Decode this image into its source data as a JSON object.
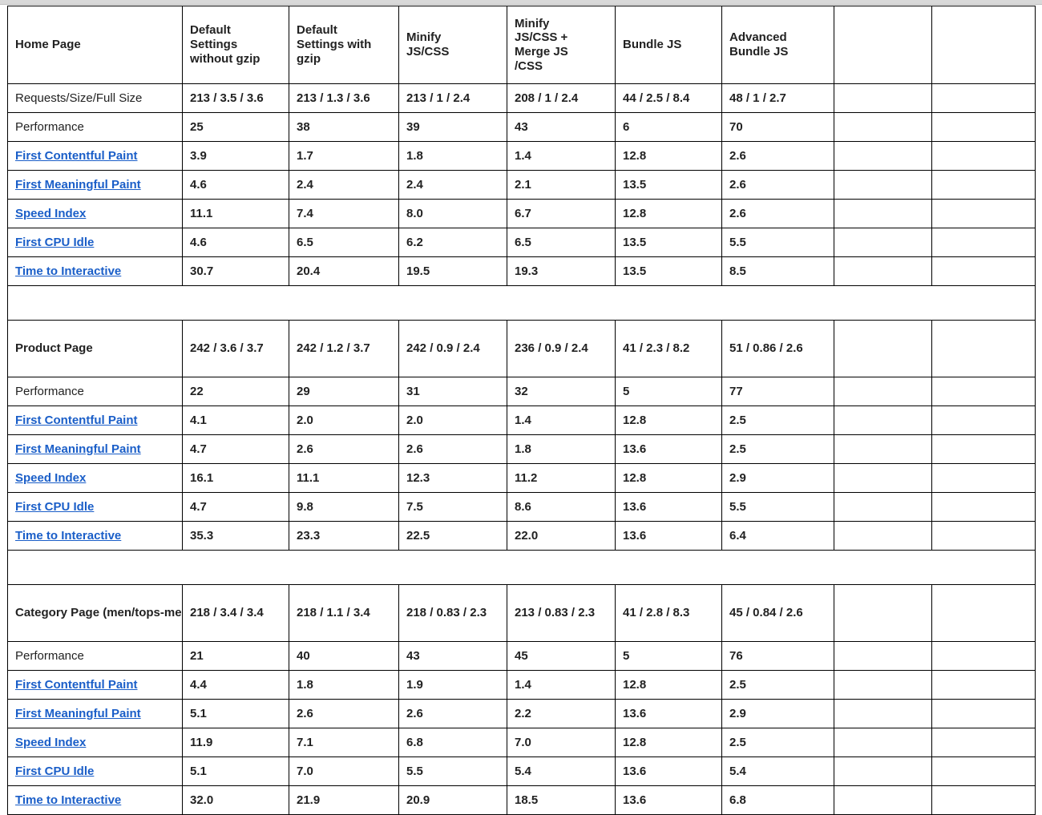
{
  "table": {
    "columns": [
      "",
      "Default Settings without  gzip",
      "Default Settings with gzip",
      "Minify JS/CSS",
      "Minify JS/CSS + Merge JS /CSS",
      "Bundle JS",
      "Advanced Bundle JS",
      "",
      ""
    ],
    "header": {
      "title": "Home Page",
      "scenarios": [
        "Default\nSettings\nwithout  gzip",
        "Default\nSettings with\ngzip",
        "Minify\nJS/CSS",
        "Minify\nJS/CSS +\nMerge JS\n/CSS",
        "Bundle JS",
        "Advanced\nBundle JS",
        "",
        ""
      ]
    },
    "sections": [
      {
        "id": "home-page",
        "title": "Home Page",
        "is_header_section": true,
        "rows": [
          {
            "label": "Requests/Size/Full Size",
            "label_style": "plain",
            "cells": [
              {
                "text": "213 / 3.5 / 3.6",
                "color": "black"
              },
              {
                "text": "213 / 1.3 / 3.6",
                "color": "black"
              },
              {
                "text": "213 / 1 / 2.4",
                "color": "black"
              },
              {
                "text": "208 / 1 / 2.4",
                "color": "black"
              },
              {
                "text": "44 / 2.5 / 8.4",
                "color": "black"
              },
              {
                "text": "48 / 1 / 2.7",
                "color": "black"
              },
              {
                "text": "",
                "color": "black"
              },
              {
                "text": "",
                "color": "black"
              }
            ]
          },
          {
            "label": "Performance",
            "label_style": "plain",
            "cells": [
              {
                "text": "25",
                "color": "black"
              },
              {
                "text": "38",
                "color": "black"
              },
              {
                "text": "39",
                "color": "black"
              },
              {
                "text": "43",
                "color": "black"
              },
              {
                "text": "6",
                "color": "black"
              },
              {
                "text": "70",
                "color": "black"
              },
              {
                "text": "",
                "color": "black"
              },
              {
                "text": "",
                "color": "black"
              }
            ]
          },
          {
            "label": "First Contentful Paint",
            "label_style": "link",
            "cells": [
              {
                "text": "3.9",
                "color": "orange"
              },
              {
                "text": "1.7",
                "color": "green"
              },
              {
                "text": "1.8",
                "color": "green"
              },
              {
                "text": "1.4",
                "color": "green"
              },
              {
                "text": "12.8",
                "color": "red"
              },
              {
                "text": "2.6",
                "color": "orange"
              },
              {
                "text": "",
                "color": "black"
              },
              {
                "text": "",
                "color": "black"
              }
            ]
          },
          {
            "label": "First Meaningful Paint",
            "label_style": "link",
            "cells": [
              {
                "text": "4.6",
                "color": "red"
              },
              {
                "text": "2.4",
                "color": "orange"
              },
              {
                "text": "2.4",
                "color": "orange"
              },
              {
                "text": "2.1",
                "color": "green"
              },
              {
                "text": "13.5",
                "color": "red"
              },
              {
                "text": "2.6",
                "color": "orange"
              },
              {
                "text": "",
                "color": "black"
              },
              {
                "text": "",
                "color": "black"
              }
            ]
          },
          {
            "label": "Speed Index",
            "label_style": "link",
            "cells": [
              {
                "text": "11.1",
                "color": "red"
              },
              {
                "text": "7.4",
                "color": "red"
              },
              {
                "text": "8.0",
                "color": "red"
              },
              {
                "text": "6.7",
                "color": "red"
              },
              {
                "text": "12.8",
                "color": "red"
              },
              {
                "text": "2.6",
                "color": "green"
              },
              {
                "text": "",
                "color": "black"
              },
              {
                "text": "",
                "color": "black"
              }
            ]
          },
          {
            "label": "First CPU Idle",
            "label_style": "link",
            "cells": [
              {
                "text": "4.6",
                "color": "orange"
              },
              {
                "text": "6.5",
                "color": "orange"
              },
              {
                "text": "6.2",
                "color": "orange"
              },
              {
                "text": "6.5",
                "color": "red"
              },
              {
                "text": "13.5",
                "color": "red"
              },
              {
                "text": "5.5",
                "color": "orange"
              },
              {
                "text": "",
                "color": "black"
              },
              {
                "text": "",
                "color": "black"
              }
            ]
          },
          {
            "label": "Time to Interactive",
            "label_style": "link",
            "cells": [
              {
                "text": "30.7",
                "color": "red"
              },
              {
                "text": "20.4",
                "color": "red"
              },
              {
                "text": "19.5",
                "color": "red"
              },
              {
                "text": "19.3",
                "color": "red"
              },
              {
                "text": "13.5",
                "color": "red"
              },
              {
                "text": "8.5",
                "color": "red"
              },
              {
                "text": "",
                "color": "black"
              },
              {
                "text": "",
                "color": "black"
              }
            ]
          }
        ]
      },
      {
        "id": "product-page",
        "title": "Product Page",
        "is_header_section": false,
        "header_cells": [
          {
            "text": "242 / 3.6 / 3.7",
            "color": "black"
          },
          {
            "text": "242 / 1.2 / 3.7",
            "color": "black"
          },
          {
            "text": "242 / 0.9 / 2.4",
            "color": "black"
          },
          {
            "text": "236 / 0.9 / 2.4",
            "color": "black"
          },
          {
            "text": "41 / 2.3 / 8.2",
            "color": "black"
          },
          {
            "text": "51 / 0.86 / 2.6",
            "color": "black"
          },
          {
            "text": "",
            "color": "black"
          },
          {
            "text": "",
            "color": "black"
          }
        ],
        "rows": [
          {
            "label": "Performance",
            "label_style": "plain",
            "cells": [
              {
                "text": "22",
                "color": "black"
              },
              {
                "text": "29",
                "color": "black"
              },
              {
                "text": "31",
                "color": "black"
              },
              {
                "text": "32",
                "color": "black"
              },
              {
                "text": "5",
                "color": "black"
              },
              {
                "text": "77",
                "color": "black"
              },
              {
                "text": "",
                "color": "black"
              },
              {
                "text": "",
                "color": "black"
              }
            ]
          },
          {
            "label": "First Contentful Paint",
            "label_style": "link",
            "cells": [
              {
                "text": "4.1",
                "color": "red"
              },
              {
                "text": "2.0",
                "color": "green"
              },
              {
                "text": "2.0",
                "color": "green"
              },
              {
                "text": "1.4",
                "color": "green"
              },
              {
                "text": "12.8",
                "color": "red"
              },
              {
                "text": "2.5",
                "color": "orange"
              },
              {
                "text": "",
                "color": "black"
              },
              {
                "text": "",
                "color": "black"
              }
            ]
          },
          {
            "label": "First Meaningful Paint",
            "label_style": "link",
            "cells": [
              {
                "text": "4.7",
                "color": "red"
              },
              {
                "text": "2.6",
                "color": "orange"
              },
              {
                "text": "2.6",
                "color": "orange"
              },
              {
                "text": "1.8",
                "color": "green"
              },
              {
                "text": "13.6",
                "color": "red"
              },
              {
                "text": "2.5",
                "color": "orange"
              },
              {
                "text": "",
                "color": "black"
              },
              {
                "text": "",
                "color": "black"
              }
            ]
          },
          {
            "label": "Speed Index",
            "label_style": "link",
            "cells": [
              {
                "text": "16.1",
                "color": "red"
              },
              {
                "text": "11.1",
                "color": "red"
              },
              {
                "text": "12.3",
                "color": "red"
              },
              {
                "text": "11.2",
                "color": "red"
              },
              {
                "text": "12.8",
                "color": "red"
              },
              {
                "text": "2.9",
                "color": "green"
              },
              {
                "text": "",
                "color": "black"
              },
              {
                "text": "",
                "color": "black"
              }
            ]
          },
          {
            "label": "First CPU Idle",
            "label_style": "link",
            "cells": [
              {
                "text": "4.7",
                "color": "orange"
              },
              {
                "text": "9.8",
                "color": "red"
              },
              {
                "text": "7.5",
                "color": "red"
              },
              {
                "text": "8.6",
                "color": "red"
              },
              {
                "text": "13.6",
                "color": "red"
              },
              {
                "text": "5.5",
                "color": "orange"
              },
              {
                "text": "",
                "color": "black"
              },
              {
                "text": "",
                "color": "black"
              }
            ]
          },
          {
            "label": "Time to Interactive",
            "label_style": "link",
            "cells": [
              {
                "text": "35.3",
                "color": "red"
              },
              {
                "text": "23.3",
                "color": "red"
              },
              {
                "text": "22.5",
                "color": "red"
              },
              {
                "text": "22.0",
                "color": "red"
              },
              {
                "text": "13.6",
                "color": "red"
              },
              {
                "text": "6.4",
                "color": "orange"
              },
              {
                "text": "",
                "color": "black"
              },
              {
                "text": "",
                "color": "black"
              }
            ]
          }
        ]
      },
      {
        "id": "category-page",
        "title": "Category Page (men/tops-men.html)",
        "is_header_section": false,
        "header_cells": [
          {
            "text": "218 / 3.4 / 3.4",
            "color": "black"
          },
          {
            "text": "218 / 1.1 / 3.4",
            "color": "black"
          },
          {
            "text": "218 / 0.83 / 2.3",
            "color": "black"
          },
          {
            "text": "213 / 0.83 / 2.3",
            "color": "black"
          },
          {
            "text": "41 / 2.8 / 8.3",
            "color": "black"
          },
          {
            "text": "45 / 0.84 / 2.6",
            "color": "black"
          },
          {
            "text": "",
            "color": "black"
          },
          {
            "text": "",
            "color": "black"
          }
        ],
        "rows": [
          {
            "label": "Performance",
            "label_style": "plain",
            "cells": [
              {
                "text": "21",
                "color": "black"
              },
              {
                "text": "40",
                "color": "small-green"
              },
              {
                "text": "43",
                "color": "black"
              },
              {
                "text": "45",
                "color": "black"
              },
              {
                "text": "5",
                "color": "black"
              },
              {
                "text": "76",
                "color": "black"
              },
              {
                "text": "",
                "color": "black"
              },
              {
                "text": "",
                "color": "black"
              }
            ]
          },
          {
            "label": "First Contentful Paint",
            "label_style": "link",
            "cells": [
              {
                "text": "4.4",
                "color": "red"
              },
              {
                "text": "1.8",
                "color": "green"
              },
              {
                "text": "1.9",
                "color": "green"
              },
              {
                "text": "1.4",
                "color": "green"
              },
              {
                "text": "12.8",
                "color": "red"
              },
              {
                "text": "2.5",
                "color": "orange"
              },
              {
                "text": "",
                "color": "black"
              },
              {
                "text": "",
                "color": "black"
              }
            ]
          },
          {
            "label": "First Meaningful Paint",
            "label_style": "link",
            "cells": [
              {
                "text": "5.1",
                "color": "red"
              },
              {
                "text": "2.6",
                "color": "orange"
              },
              {
                "text": "2.6",
                "color": "orange"
              },
              {
                "text": "2.2",
                "color": "green"
              },
              {
                "text": "13.6",
                "color": "red"
              },
              {
                "text": "2.9",
                "color": "orange"
              },
              {
                "text": "",
                "color": "black"
              },
              {
                "text": "",
                "color": "black"
              }
            ]
          },
          {
            "label": "Speed Index",
            "label_style": "link",
            "cells": [
              {
                "text": "11.9",
                "color": "red"
              },
              {
                "text": "7.1",
                "color": "red"
              },
              {
                "text": "6.8",
                "color": "red"
              },
              {
                "text": "7.0",
                "color": "red"
              },
              {
                "text": "12.8",
                "color": "red"
              },
              {
                "text": "2.5",
                "color": "green"
              },
              {
                "text": "",
                "color": "black"
              },
              {
                "text": "",
                "color": "black"
              }
            ]
          },
          {
            "label": "First CPU Idle",
            "label_style": "link",
            "cells": [
              {
                "text": "5.1",
                "color": "orange"
              },
              {
                "text": "7.0",
                "color": "red"
              },
              {
                "text": "5.5",
                "color": "orange"
              },
              {
                "text": "5.4",
                "color": "orange"
              },
              {
                "text": "13.6",
                "color": "red"
              },
              {
                "text": "5.4",
                "color": "orange"
              },
              {
                "text": "",
                "color": "black"
              },
              {
                "text": "",
                "color": "black"
              }
            ]
          },
          {
            "label": "Time to Interactive",
            "label_style": "link",
            "cells": [
              {
                "text": "32.0",
                "color": "red"
              },
              {
                "text": "21.9",
                "color": "red"
              },
              {
                "text": "20.9",
                "color": "red"
              },
              {
                "text": "18.5",
                "color": "red"
              },
              {
                "text": "13.6",
                "color": "red"
              },
              {
                "text": "6.8",
                "color": "orange"
              },
              {
                "text": "",
                "color": "black"
              },
              {
                "text": "",
                "color": "black"
              }
            ]
          }
        ]
      }
    ],
    "colors": {
      "good": "#117a32",
      "average": "#e8870e",
      "poor": "#b5202c",
      "link": "#1a5ec8",
      "text": "#1a1a1a",
      "border": "#000000"
    }
  }
}
